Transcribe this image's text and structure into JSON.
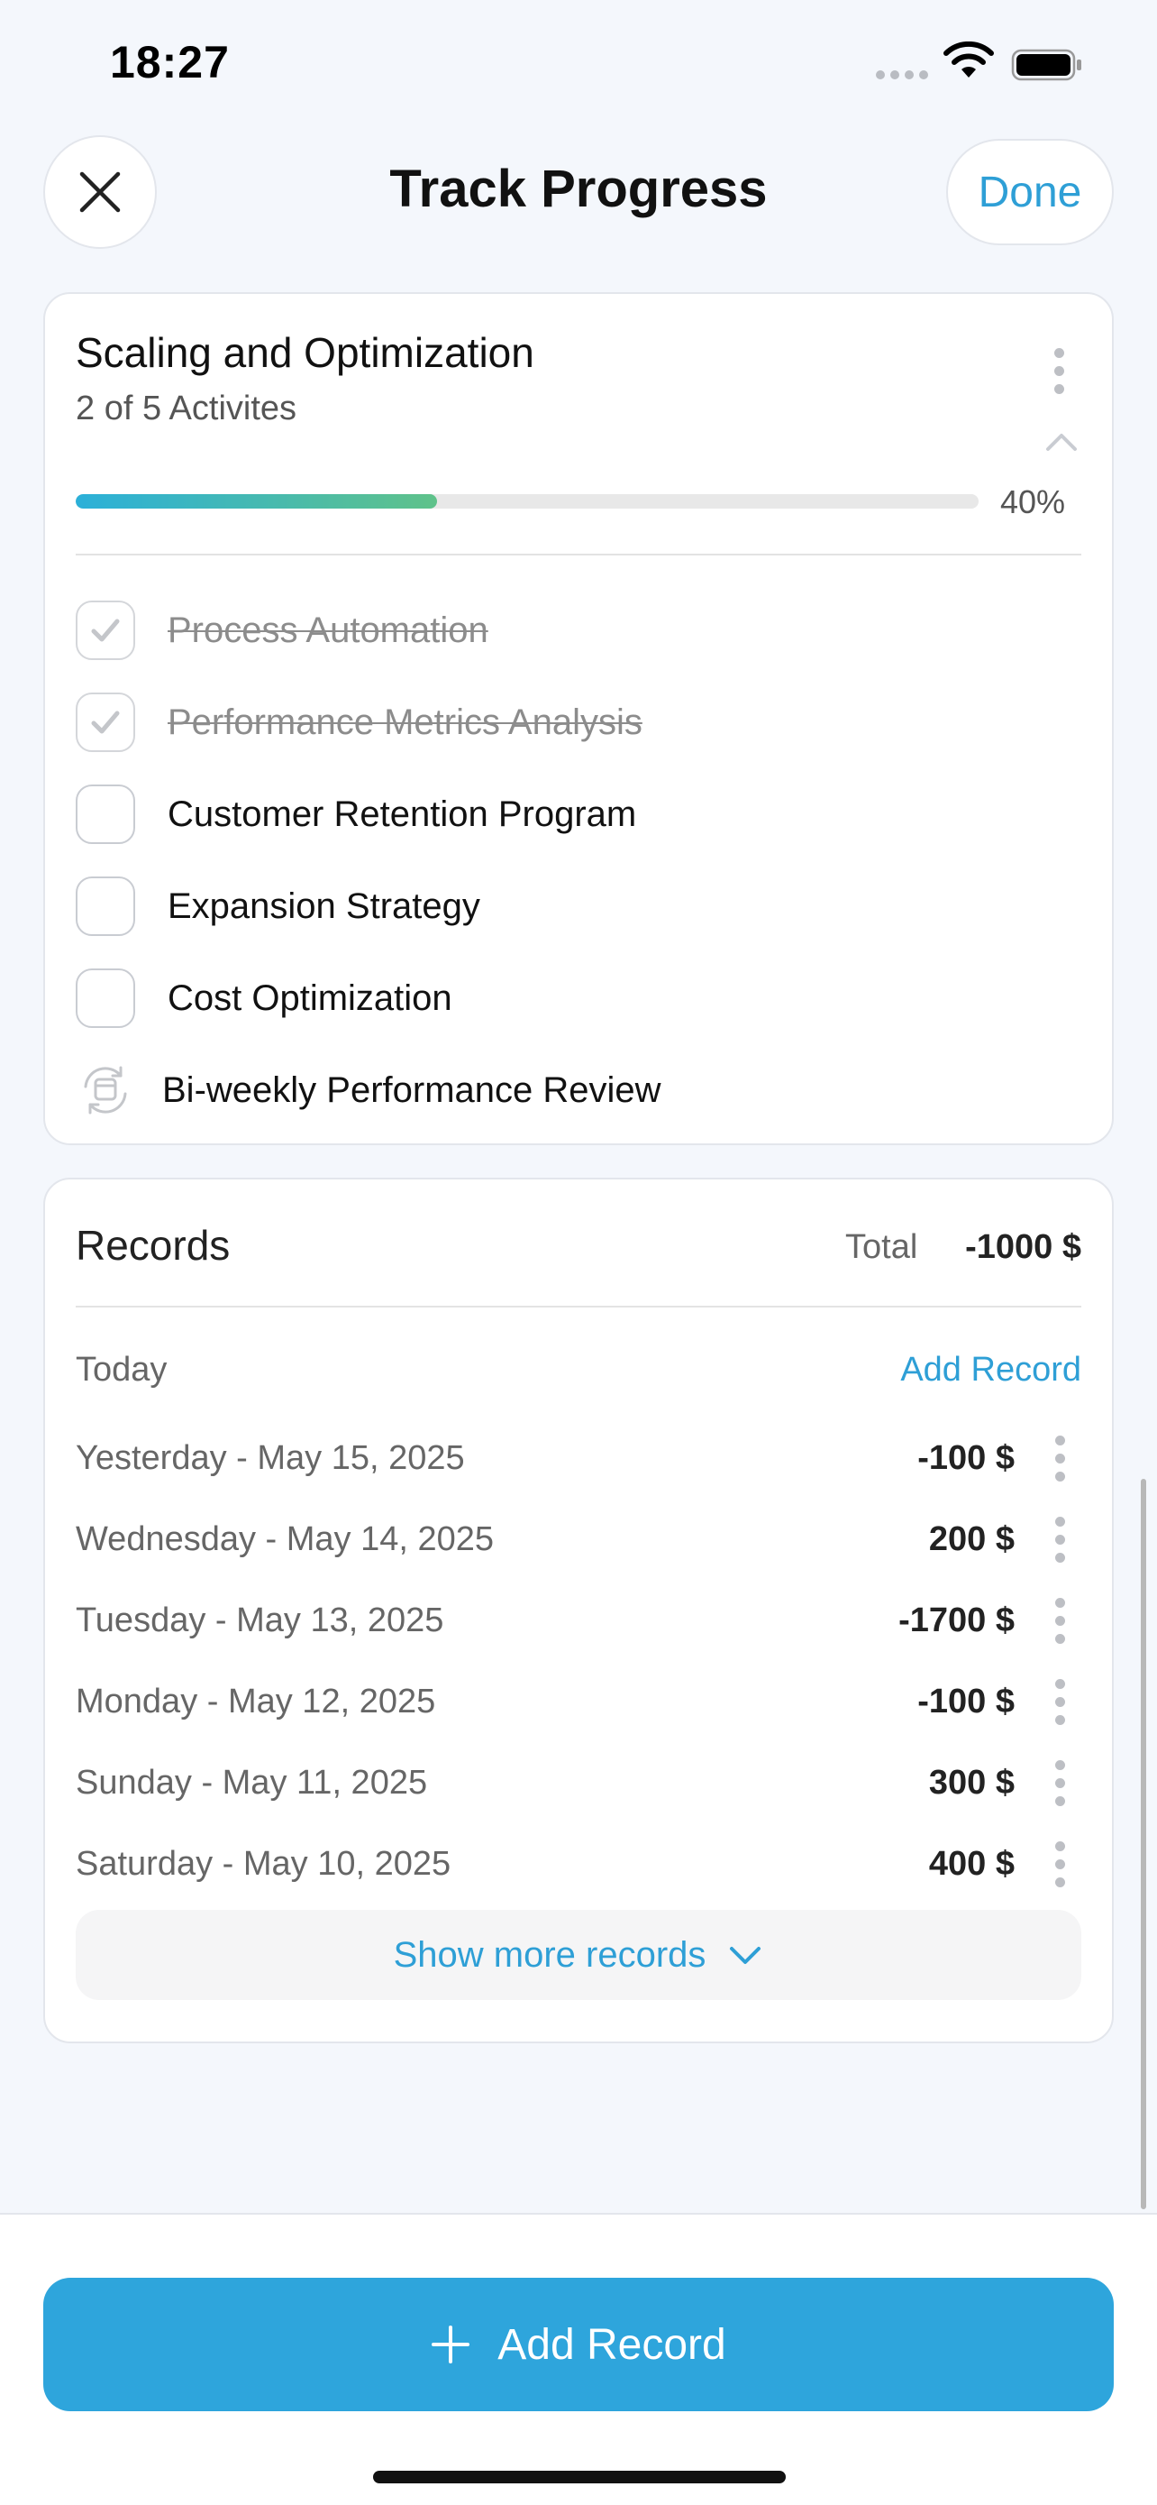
{
  "status_bar": {
    "time": "18:27"
  },
  "header": {
    "title": "Track Progress",
    "done_label": "Done"
  },
  "goal": {
    "title": "Scaling and Optimization",
    "subtitle": "2 of 5 Activites",
    "progress_fraction": 0.4,
    "progress_label": "40%",
    "activities": [
      {
        "label": "Process Automation",
        "completed": true
      },
      {
        "label": "Performance Metrics Analysis",
        "completed": true
      },
      {
        "label": "Customer Retention Program",
        "completed": false
      },
      {
        "label": "Expansion Strategy",
        "completed": false
      },
      {
        "label": "Cost Optimization",
        "completed": false
      },
      {
        "label": "Bi-weekly Performance Review",
        "recurring": true
      }
    ]
  },
  "records": {
    "title": "Records",
    "total_label": "Total",
    "total_value": "-1000 $",
    "today_label": "Today",
    "add_record_link": "Add Record",
    "items": [
      {
        "date": "Yesterday - May 15, 2025",
        "amount": "-100 $"
      },
      {
        "date": "Wednesday - May 14, 2025",
        "amount": "200 $"
      },
      {
        "date": "Tuesday - May 13, 2025",
        "amount": "-1700 $"
      },
      {
        "date": "Monday - May 12, 2025",
        "amount": "-100 $"
      },
      {
        "date": "Sunday - May 11, 2025",
        "amount": "300 $"
      },
      {
        "date": "Saturday - May 10, 2025",
        "amount": "400 $"
      }
    ],
    "show_more_label": "Show more records"
  },
  "footer": {
    "add_record_label": "Add Record"
  },
  "colors": {
    "accent": "#2ea5dc",
    "link": "#2e9fd6",
    "progress_start": "#2bb0d9",
    "progress_end": "#5fc28a"
  },
  "icons": {
    "close": "close-icon",
    "more": "more-vertical-icon",
    "collapse": "chevron-up-icon",
    "check": "checkmark-icon",
    "recurring": "recurring-icon",
    "expand": "chevron-down-icon",
    "add": "plus-icon"
  }
}
